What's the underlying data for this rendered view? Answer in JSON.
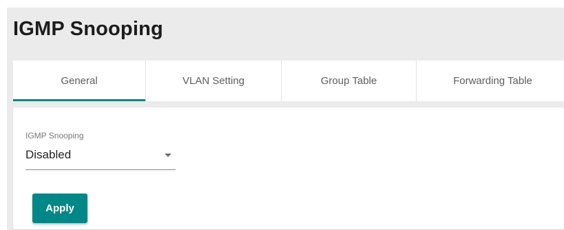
{
  "header": {
    "title": "IGMP Snooping"
  },
  "tabs": [
    {
      "label": "General",
      "active": true
    },
    {
      "label": "VLAN Setting",
      "active": false
    },
    {
      "label": "Group Table",
      "active": false
    },
    {
      "label": "Forwarding Table",
      "active": false
    }
  ],
  "form": {
    "igmp_snooping_label": "IGMP Snooping",
    "igmp_snooping_value": "Disabled",
    "apply_label": "Apply"
  },
  "colors": {
    "accent": "#008787",
    "panel_background": "#ebebeb"
  },
  "icons": {
    "dropdown": "caret-down-icon"
  }
}
